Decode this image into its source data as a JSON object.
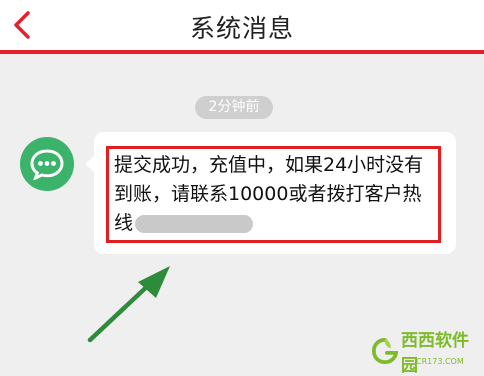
{
  "header": {
    "title": "系统消息"
  },
  "message": {
    "time": "2分钟前",
    "text": "提交成功，充值中，如果24小时没有到账，请联系10000或者拨打客户热线"
  },
  "watermark": {
    "brand": "西西软件园",
    "domain": "CR173.COM"
  },
  "colors": {
    "accent": "#e5202c",
    "avatar": "#3bb36a",
    "highlight": "#e02020",
    "arrow": "#2e8b3a",
    "watermark": "#7dbb2a"
  },
  "icons": {
    "back": "chevron-left-icon",
    "avatar": "chat-bubble-icon",
    "annotation": "arrow-icon"
  }
}
